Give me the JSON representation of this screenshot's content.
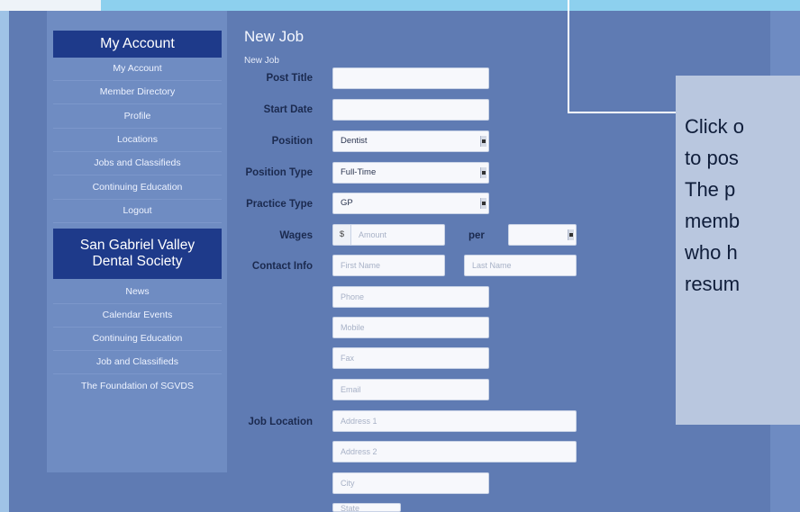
{
  "sidebar": {
    "my_account_heading": "My Account",
    "account_items": [
      "My Account",
      "Member Directory",
      "Profile",
      "Locations",
      "Jobs and Classifieds",
      "Continuing Education",
      "Logout"
    ],
    "society_heading_line1": "San Gabriel Valley",
    "society_heading_line2": "Dental Society",
    "society_items": [
      "News",
      "Calendar Events",
      "Continuing Education",
      "Job and Classifieds",
      "The Foundation of SGVDS"
    ]
  },
  "form": {
    "title": "New Job",
    "subtitle": "New Job",
    "labels": {
      "post_title": "Post Title",
      "start_date": "Start Date",
      "position": "Position",
      "position_type": "Position Type",
      "practice_type": "Practice Type",
      "wages": "Wages",
      "per": "per",
      "contact_info": "Contact Info",
      "job_location": "Job Location"
    },
    "values": {
      "position": "Dentist",
      "position_type": "Full-Time",
      "practice_type": "GP",
      "currency": "$"
    },
    "placeholders": {
      "amount": "Amount",
      "first_name": "First Name",
      "last_name": "Last Name",
      "phone": "Phone",
      "mobile": "Mobile",
      "fax": "Fax",
      "email": "Email",
      "address1": "Address 1",
      "address2": "Address 2",
      "city": "City",
      "state": "State"
    }
  },
  "callout": {
    "lines": [
      "Click o",
      "to pos",
      "The p",
      "memb",
      "who h",
      "resum"
    ]
  }
}
